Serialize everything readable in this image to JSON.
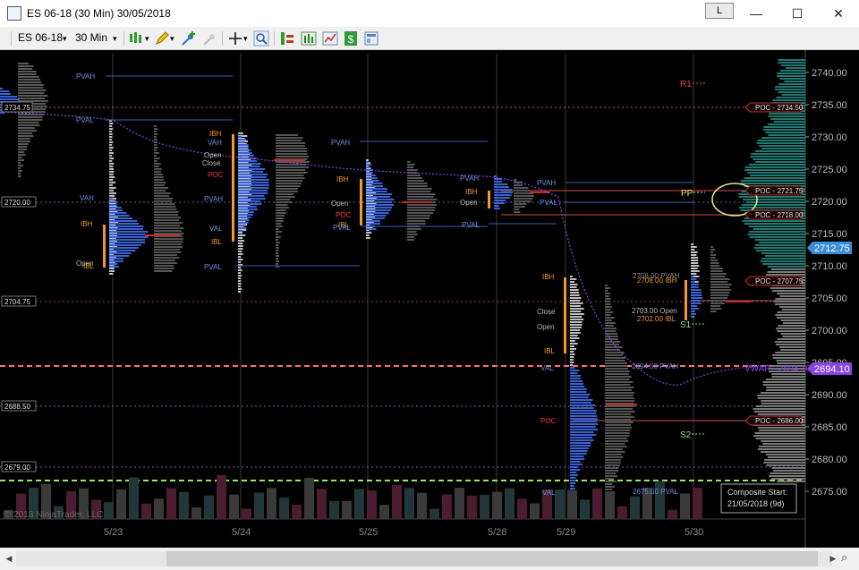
{
  "window": {
    "title": "ES 06-18 (30 Min)  30/05/2018",
    "l_button": "L",
    "minimize_glyph": "—",
    "maximize_glyph": "☐",
    "close_glyph": "✕"
  },
  "toolbar": {
    "instrument": "ES 06-18",
    "interval": "30 Min",
    "dropdown_glyph": "▾"
  },
  "chart": {
    "copyright": "© 2018 NinjaTrader, LLC",
    "composite_box": {
      "line1": "Composite Start:",
      "line2": "21/05/2018 (9d)"
    },
    "x_dates": [
      "5/23",
      "5/24",
      "5/25",
      "5/28",
      "5/29",
      "5/30"
    ],
    "price_axis": [
      "2740.00",
      "2735.00",
      "2730.00",
      "2725.00",
      "2720.00",
      "2715.00",
      "2710.00",
      "2705.00",
      "2700.00",
      "2695.00",
      "2690.00",
      "2685.00",
      "2680.00",
      "2675.00"
    ],
    "current_price": "2712.75",
    "vwap_price": "2694.10",
    "vwap_label": "VWAP - 2694.10",
    "left_prices": [
      "2734.75",
      "2720.00",
      "2704.75",
      "2688.50",
      "2679.00"
    ],
    "poc_tags": [
      "POC - 2734.50",
      "POC - 2721.75",
      "POC - 2718.00",
      "POC - 2707.75",
      "POC - 2686.00"
    ],
    "pivots": [
      "R1",
      "PP",
      "S1",
      "S2"
    ],
    "day_labels": {
      "pvah": "PVAH",
      "pval": "PVAL",
      "vah": "VAH",
      "val": "VAL",
      "poc": "POC",
      "ibh": "IBH",
      "ibl": "IBL",
      "open": "Open",
      "close": "Close"
    },
    "price_tags": {
      "ibh_2708": "2708.00 IBH",
      "pvah_2708": "2708.00 PVAH",
      "open_2703": "2703.00 Open",
      "ibl_2702": "2702.00 IBL",
      "pvah_2694": "2694.50 PVAH",
      "pval_2675": "2675.00 PVAL"
    }
  }
}
